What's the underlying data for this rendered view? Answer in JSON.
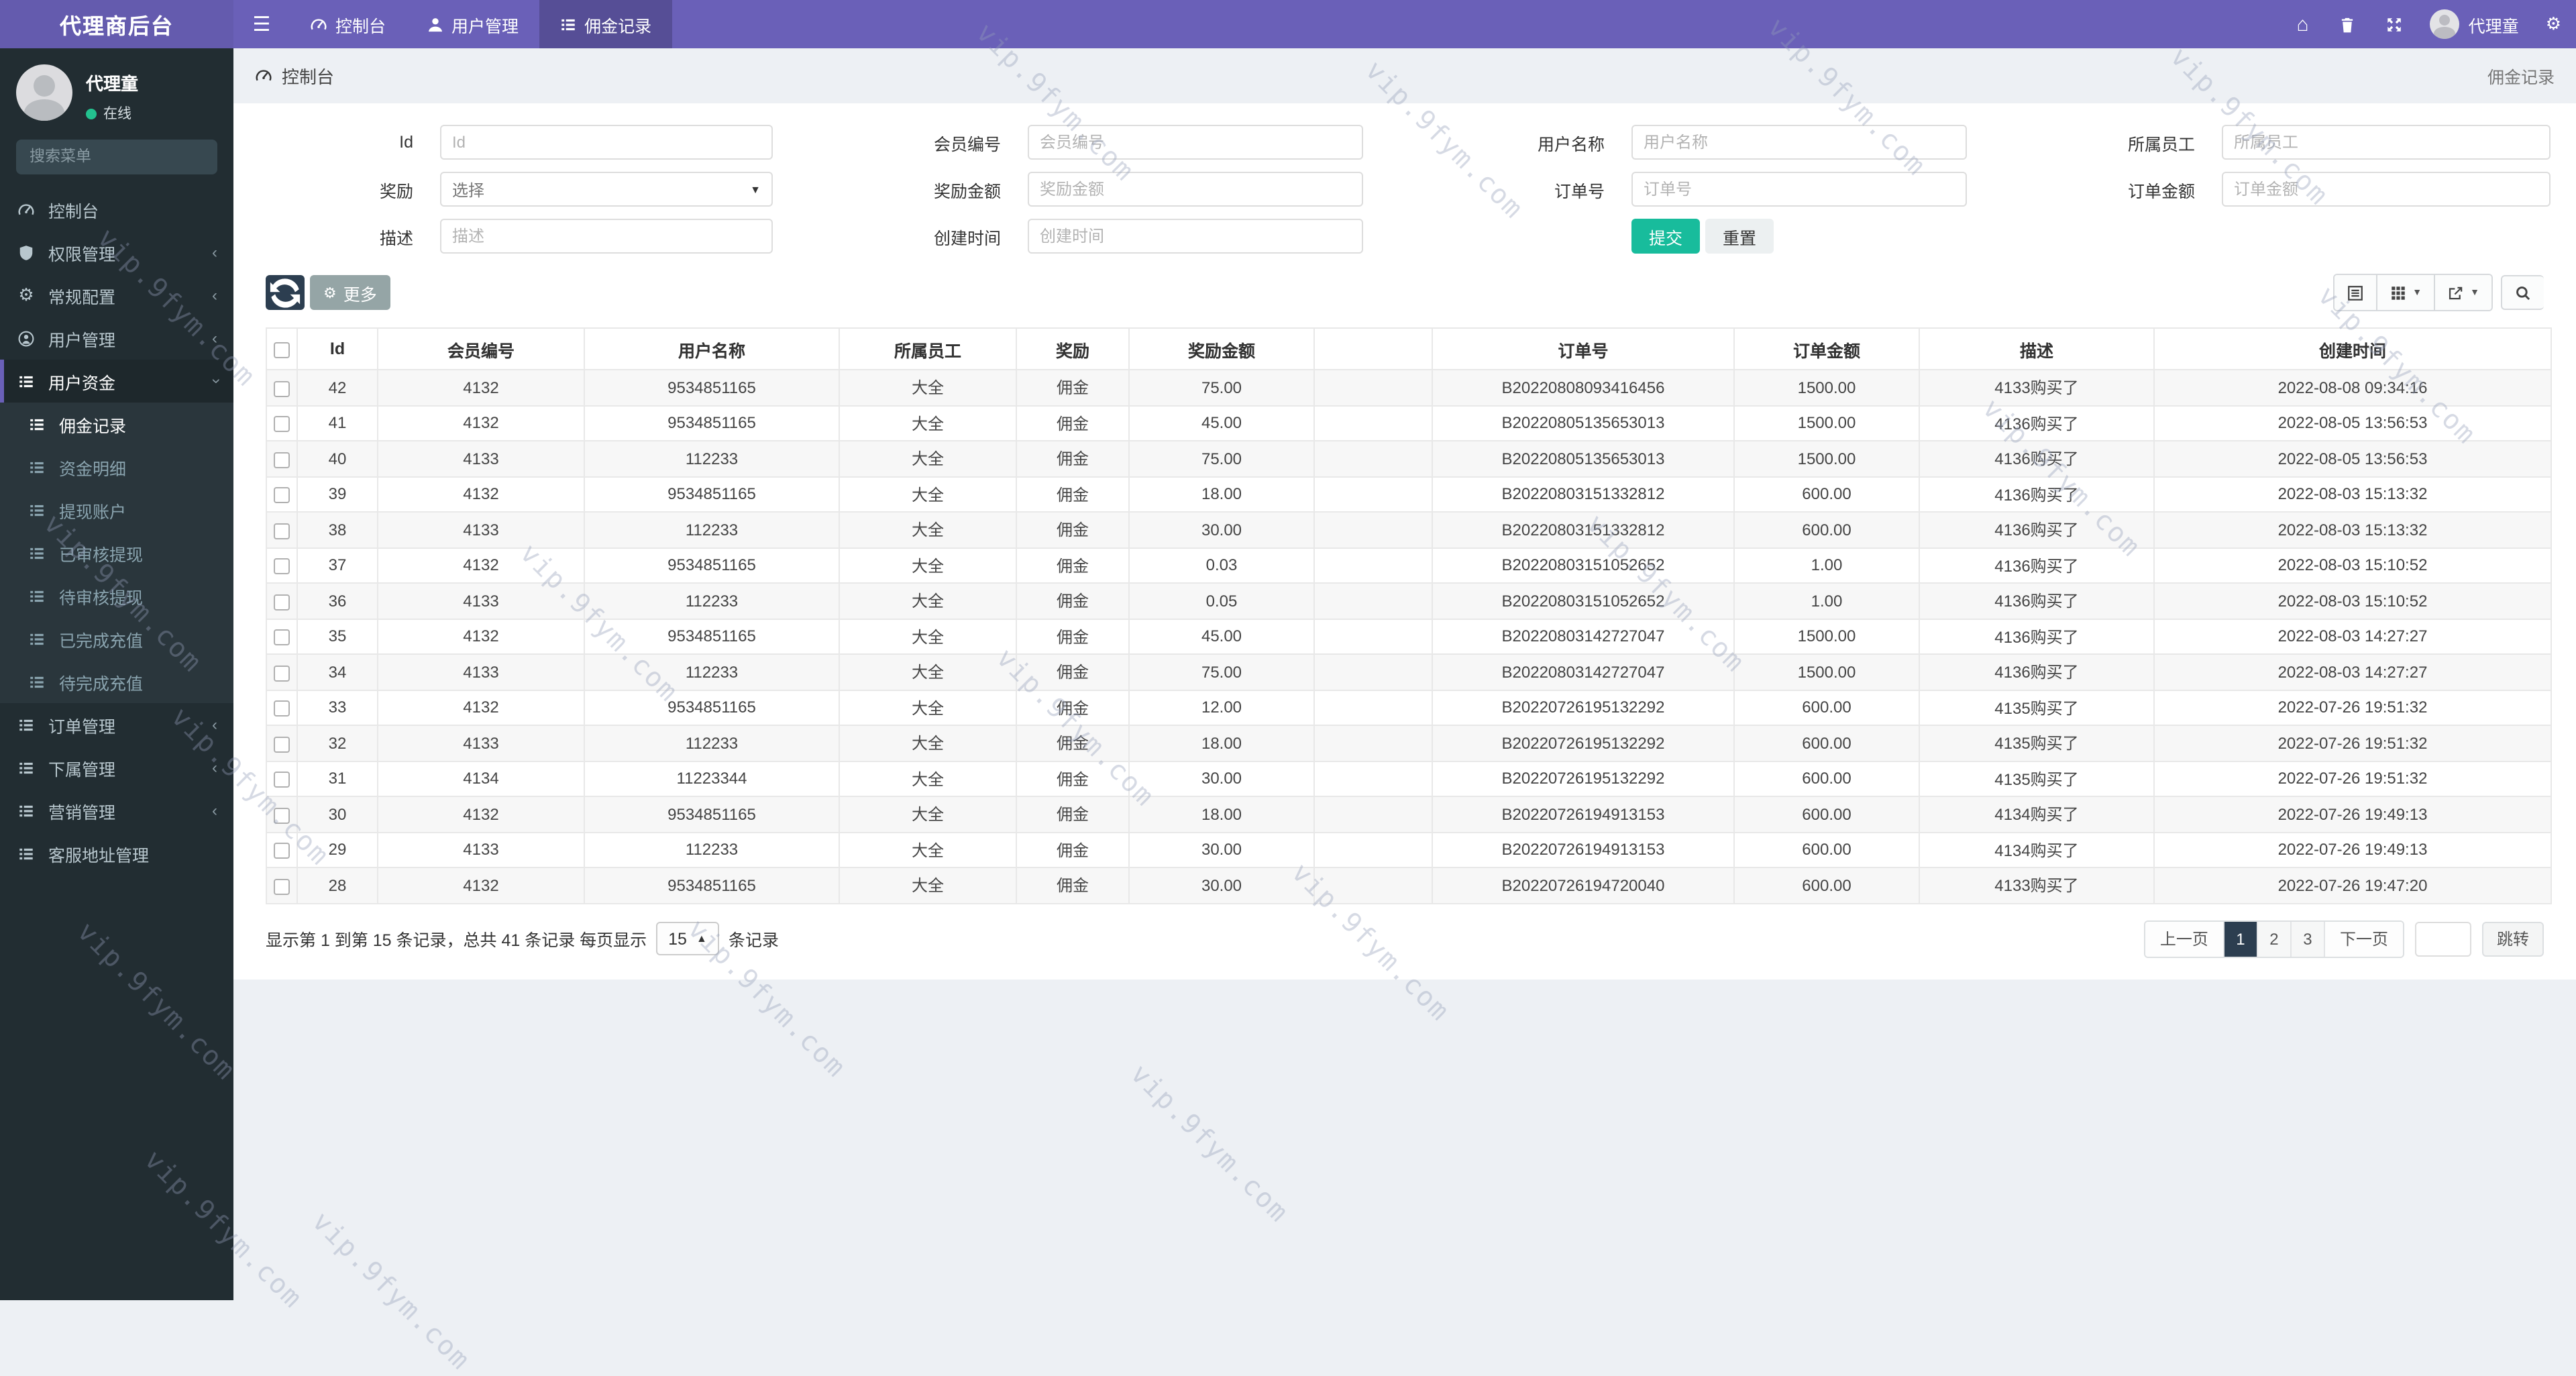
{
  "app": {
    "title": "代理商后台"
  },
  "icons": {
    "gears": "⚙",
    "home": "⌂",
    "hamburger": "☰",
    "caret_down": "▼",
    "caret_up": "▲",
    "chevron": "‹"
  },
  "topnav": {
    "items": [
      {
        "label": "控制台",
        "icon": "dashboard-icon",
        "active": false
      },
      {
        "label": "用户管理",
        "icon": "user-icon",
        "active": false
      },
      {
        "label": "佣金记录",
        "icon": "list-icon",
        "active": true
      }
    ],
    "user": "代理童"
  },
  "sidebar": {
    "user": {
      "name": "代理童",
      "status": "在线"
    },
    "search_placeholder": "搜索菜单",
    "menu": [
      {
        "label": "控制台",
        "icon": "dashboard-icon"
      },
      {
        "label": "权限管理",
        "icon": "shield-icon",
        "chevron": "left"
      },
      {
        "label": "常规配置",
        "icon": "gears-icon",
        "chevron": "left"
      },
      {
        "label": "用户管理",
        "icon": "user-circle-icon",
        "chevron": "left"
      },
      {
        "label": "用户资金",
        "icon": "list-icon",
        "chevron": "down",
        "active": true,
        "children": [
          {
            "label": "佣金记录",
            "active": true
          },
          {
            "label": "资金明细"
          },
          {
            "label": "提现账户"
          },
          {
            "label": "已审核提现"
          },
          {
            "label": "待审核提现"
          },
          {
            "label": "已完成充值"
          },
          {
            "label": "待完成充值"
          }
        ]
      },
      {
        "label": "订单管理",
        "icon": "list-icon",
        "chevron": "left"
      },
      {
        "label": "下属管理",
        "icon": "list-icon",
        "chevron": "left"
      },
      {
        "label": "营销管理",
        "icon": "list-icon",
        "chevron": "left"
      },
      {
        "label": "客服地址管理",
        "icon": "list-icon"
      }
    ]
  },
  "breadcrumb": {
    "left": "控制台",
    "right": "佣金记录"
  },
  "filter": {
    "fields": [
      {
        "label": "Id",
        "placeholder": "Id",
        "type": "input"
      },
      {
        "label": "会员编号",
        "placeholder": "会员编号",
        "type": "input"
      },
      {
        "label": "用户名称",
        "placeholder": "用户名称",
        "type": "input"
      },
      {
        "label": "所属员工",
        "placeholder": "所属员工",
        "type": "input"
      },
      {
        "label": "奖励",
        "value": "选择",
        "type": "select"
      },
      {
        "label": "奖励金额",
        "placeholder": "奖励金额",
        "type": "input"
      },
      {
        "label": "订单号",
        "placeholder": "订单号",
        "type": "input"
      },
      {
        "label": "订单金额",
        "placeholder": "订单金额",
        "type": "input"
      },
      {
        "label": "描述",
        "placeholder": "描述",
        "type": "input"
      },
      {
        "label": "创建时间",
        "placeholder": "创建时间",
        "type": "input"
      }
    ],
    "submit": "提交",
    "reset": "重置"
  },
  "toolbar": {
    "more": "更多"
  },
  "table": {
    "columns": [
      "Id",
      "会员编号",
      "用户名称",
      "所属员工",
      "奖励",
      "奖励金额",
      "",
      "订单号",
      "订单金额",
      "描述",
      "创建时间"
    ],
    "rows": [
      [
        "42",
        "4132",
        "9534851165",
        "大全",
        "佣金",
        "75.00",
        "",
        "B20220808093416456",
        "1500.00",
        "4133购买了",
        "2022-08-08 09:34:16"
      ],
      [
        "41",
        "4132",
        "9534851165",
        "大全",
        "佣金",
        "45.00",
        "",
        "B20220805135653013",
        "1500.00",
        "4136购买了",
        "2022-08-05 13:56:53"
      ],
      [
        "40",
        "4133",
        "112233",
        "大全",
        "佣金",
        "75.00",
        "",
        "B20220805135653013",
        "1500.00",
        "4136购买了",
        "2022-08-05 13:56:53"
      ],
      [
        "39",
        "4132",
        "9534851165",
        "大全",
        "佣金",
        "18.00",
        "",
        "B20220803151332812",
        "600.00",
        "4136购买了",
        "2022-08-03 15:13:32"
      ],
      [
        "38",
        "4133",
        "112233",
        "大全",
        "佣金",
        "30.00",
        "",
        "B20220803151332812",
        "600.00",
        "4136购买了",
        "2022-08-03 15:13:32"
      ],
      [
        "37",
        "4132",
        "9534851165",
        "大全",
        "佣金",
        "0.03",
        "",
        "B20220803151052652",
        "1.00",
        "4136购买了",
        "2022-08-03 15:10:52"
      ],
      [
        "36",
        "4133",
        "112233",
        "大全",
        "佣金",
        "0.05",
        "",
        "B20220803151052652",
        "1.00",
        "4136购买了",
        "2022-08-03 15:10:52"
      ],
      [
        "35",
        "4132",
        "9534851165",
        "大全",
        "佣金",
        "45.00",
        "",
        "B20220803142727047",
        "1500.00",
        "4136购买了",
        "2022-08-03 14:27:27"
      ],
      [
        "34",
        "4133",
        "112233",
        "大全",
        "佣金",
        "75.00",
        "",
        "B20220803142727047",
        "1500.00",
        "4136购买了",
        "2022-08-03 14:27:27"
      ],
      [
        "33",
        "4132",
        "9534851165",
        "大全",
        "佣金",
        "12.00",
        "",
        "B20220726195132292",
        "600.00",
        "4135购买了",
        "2022-07-26 19:51:32"
      ],
      [
        "32",
        "4133",
        "112233",
        "大全",
        "佣金",
        "18.00",
        "",
        "B20220726195132292",
        "600.00",
        "4135购买了",
        "2022-07-26 19:51:32"
      ],
      [
        "31",
        "4134",
        "11223344",
        "大全",
        "佣金",
        "30.00",
        "",
        "B20220726195132292",
        "600.00",
        "4135购买了",
        "2022-07-26 19:51:32"
      ],
      [
        "30",
        "4132",
        "9534851165",
        "大全",
        "佣金",
        "18.00",
        "",
        "B20220726194913153",
        "600.00",
        "4134购买了",
        "2022-07-26 19:49:13"
      ],
      [
        "29",
        "4133",
        "112233",
        "大全",
        "佣金",
        "30.00",
        "",
        "B20220726194913153",
        "600.00",
        "4134购买了",
        "2022-07-26 19:49:13"
      ],
      [
        "28",
        "4132",
        "9534851165",
        "大全",
        "佣金",
        "30.00",
        "",
        "B20220726194720040",
        "600.00",
        "4133购买了",
        "2022-07-26 19:47:20"
      ]
    ]
  },
  "pagination": {
    "info_prefix": "显示第 1 到第 15 条记录，总共 41 条记录 每页显示",
    "page_size": "15",
    "info_suffix": "条记录",
    "prev": "上一页",
    "next": "下一页",
    "pages": [
      "1",
      "2",
      "3"
    ],
    "active_page": "1",
    "jump": "跳转"
  },
  "watermark": {
    "text": "vip.9fym.com"
  }
}
